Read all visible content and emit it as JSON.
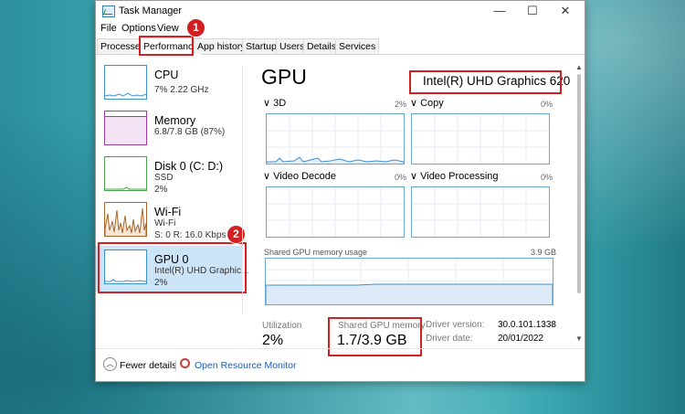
{
  "window": {
    "title": "Task Manager",
    "controls": {
      "minimize": "—",
      "maximize": "☐",
      "close": "✕"
    }
  },
  "menu": [
    "File",
    "Options",
    "View"
  ],
  "tabs": [
    "Processes",
    "Performance",
    "App history",
    "Startup",
    "Users",
    "Details",
    "Services"
  ],
  "badges": [
    "1",
    "2"
  ],
  "sidebar": {
    "items": [
      {
        "name": "CPU",
        "sub1": "7% 2.22 GHz",
        "color": "#3e8fd0"
      },
      {
        "name": "Memory",
        "sub1": "6.8/7.8 GB (87%)",
        "color": "#9a3fa3"
      },
      {
        "name": "Disk 0 (C: D:)",
        "sub1": "SSD",
        "sub2": "2%",
        "color": "#4aa24a"
      },
      {
        "name": "Wi-Fi",
        "sub1": "Wi-Fi",
        "sub2": "S: 0 R: 16.0 Kbps",
        "color": "#a8652a"
      },
      {
        "name": "GPU 0",
        "sub1": "Intel(R) UHD Graphic...",
        "sub2": "2%",
        "color": "#3e8fd0"
      }
    ]
  },
  "main": {
    "header": "GPU",
    "gpu_name": "Intel(R) UHD Graphics 620",
    "engines": [
      {
        "name": "3D",
        "pct": "2%"
      },
      {
        "name": "Copy",
        "pct": "0%"
      },
      {
        "name": "Video Decode",
        "pct": "0%"
      },
      {
        "name": "Video Processing",
        "pct": "0%"
      }
    ],
    "shared_usage_label": "Shared GPU memory usage",
    "shared_usage_max": "3.9 GB",
    "utilization_label": "Utilization",
    "utilization_value": "2%",
    "shared_mem_label": "Shared GPU memory",
    "shared_mem_value": "1.7/3.9 GB",
    "driver_version_label": "Driver version:",
    "driver_version": "30.0.101.1338",
    "driver_date_label": "Driver date:",
    "driver_date": "20/01/2022"
  },
  "footer": {
    "fewer_details": "Fewer details",
    "open_monitor": "Open Resource Monitor"
  }
}
